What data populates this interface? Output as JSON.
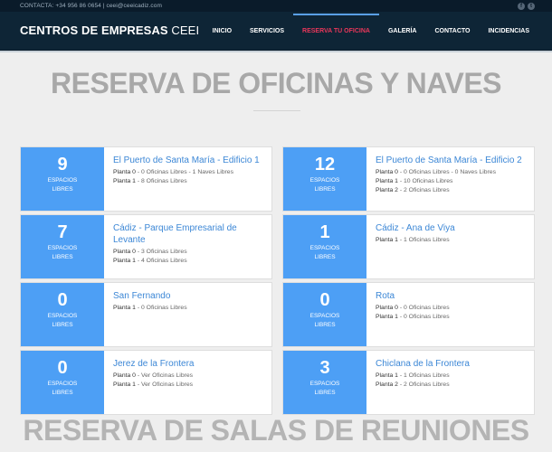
{
  "topbar": {
    "contact": "CONTACTA: +34 956 86 0654 | ceei@ceeicadiz.com",
    "social": [
      {
        "icon": "facebook-icon",
        "glyph": "f"
      },
      {
        "icon": "twitter-icon",
        "glyph": "t"
      }
    ]
  },
  "header": {
    "brand_bold": "CENTROS DE EMPRESAS",
    "brand_light": "CEEI",
    "nav": [
      {
        "label": "INICIO",
        "active": false
      },
      {
        "label": "SERVICIOS",
        "active": false
      },
      {
        "label": "RESERVA TU OFICINA",
        "active": true
      },
      {
        "label": "GALERÍA",
        "active": false
      },
      {
        "label": "CONTACTO",
        "active": false
      },
      {
        "label": "INCIDENCIAS",
        "active": false
      }
    ]
  },
  "main": {
    "title": "RESERVA DE OFICINAS Y NAVES",
    "badge_line1": "ESPACIOS",
    "badge_line2": "LIBRES",
    "cards": [
      {
        "count": "9",
        "title": "El Puerto de Santa María - Edificio 1",
        "floors": [
          {
            "planta": "Planta 0",
            "detail": " - 0 Oficinas Libres - 1 Naves Libres"
          },
          {
            "planta": "Planta 1",
            "detail": " - 8 Oficinas Libres"
          }
        ]
      },
      {
        "count": "12",
        "title": "El Puerto de Santa María - Edificio 2",
        "floors": [
          {
            "planta": "Planta 0",
            "detail": " - 0 Oficinas Libres - 0 Naves Libres"
          },
          {
            "planta": "Planta 1",
            "detail": " - 10 Oficinas Libres"
          },
          {
            "planta": "Planta 2",
            "detail": " - 2 Oficinas Libres"
          }
        ]
      },
      {
        "count": "7",
        "title": "Cádiz - Parque Empresarial de Levante",
        "floors": [
          {
            "planta": "Planta 0",
            "detail": " - 3 Oficinas Libres"
          },
          {
            "planta": "Planta 1",
            "detail": " - 4 Oficinas Libres"
          }
        ]
      },
      {
        "count": "1",
        "title": "Cádiz - Ana de Viya",
        "floors": [
          {
            "planta": "Planta 1",
            "detail": " - 1 Oficinas Libres"
          }
        ]
      },
      {
        "count": "0",
        "title": "San Fernando",
        "floors": [
          {
            "planta": "Planta 1",
            "detail": " - 0 Oficinas Libres"
          }
        ]
      },
      {
        "count": "0",
        "title": "Rota",
        "floors": [
          {
            "planta": "Planta 0",
            "detail": " - 0 Oficinas Libres"
          },
          {
            "planta": "Planta 1",
            "detail": " - 0 Oficinas Libres"
          }
        ]
      },
      {
        "count": "0",
        "title": "Jerez de la Frontera",
        "floors": [
          {
            "planta": "Planta 0",
            "detail": " - Ver Oficinas Libres"
          },
          {
            "planta": "Planta 1",
            "detail": " - Ver Oficinas Libres"
          }
        ]
      },
      {
        "count": "3",
        "title": "Chiclana de la Frontera",
        "floors": [
          {
            "planta": "Planta 1",
            "detail": " - 1 Oficinas Libres"
          },
          {
            "planta": "Planta 2",
            "detail": " - 2 Oficinas Libres"
          }
        ]
      }
    ],
    "next_section_title": "RESERVA DE SALAS DE REUNIONES"
  },
  "colors": {
    "accent_blue": "#4d9ff5",
    "link_blue": "#3c87d6",
    "nav_active": "#e8375a",
    "navbar_bg": "#0e2536"
  }
}
